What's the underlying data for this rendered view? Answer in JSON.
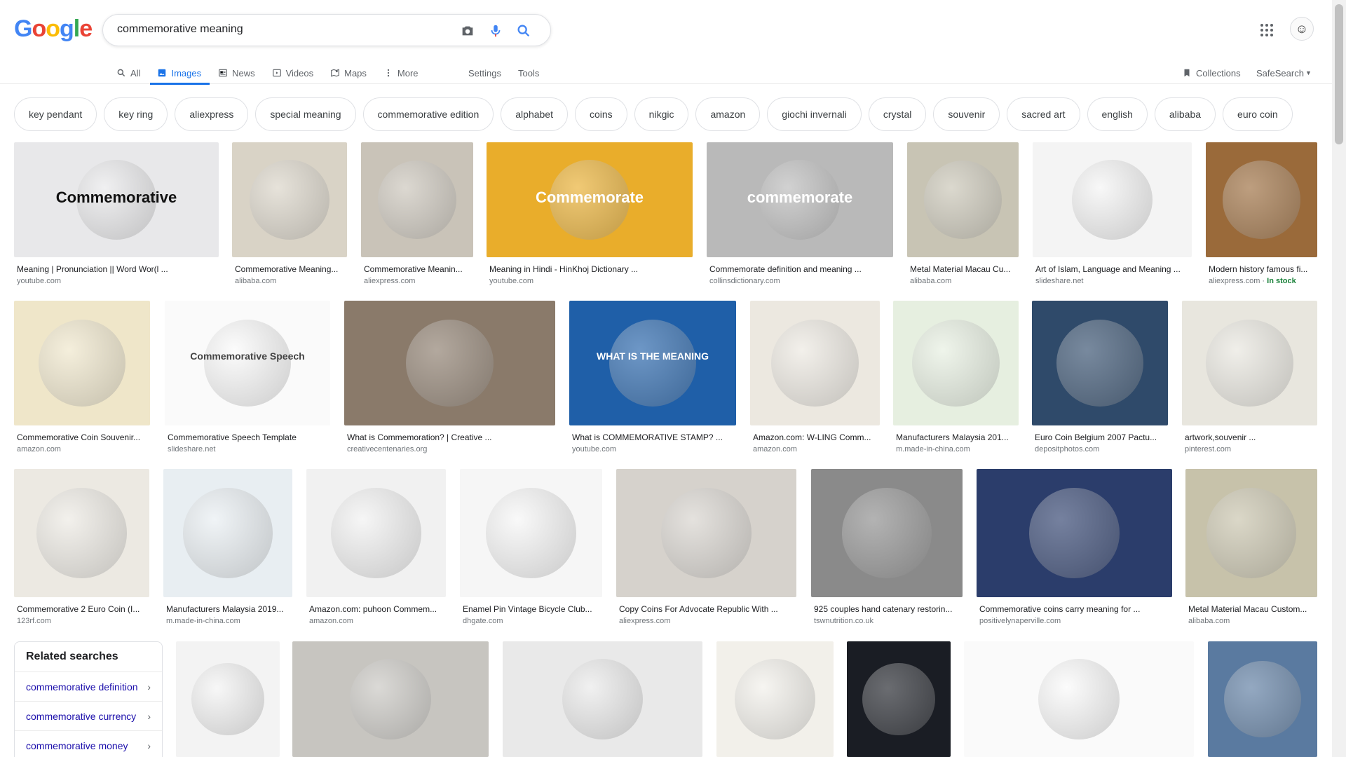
{
  "search": {
    "query": "commemorative meaning"
  },
  "logo": {
    "letters": [
      "G",
      "o",
      "o",
      "g",
      "l",
      "e"
    ],
    "colors": [
      "#4285f4",
      "#ea4335",
      "#fbbc05",
      "#4285f4",
      "#34a853",
      "#ea4335"
    ]
  },
  "tabs": [
    {
      "label": "All",
      "icon": "search-icon",
      "active": false
    },
    {
      "label": "Images",
      "icon": "image-icon",
      "active": true
    },
    {
      "label": "News",
      "icon": "news-icon",
      "active": false
    },
    {
      "label": "Videos",
      "icon": "video-icon",
      "active": false
    },
    {
      "label": "Maps",
      "icon": "map-icon",
      "active": false
    },
    {
      "label": "More",
      "icon": "more-vert-icon",
      "active": false
    }
  ],
  "tools": {
    "settings": "Settings",
    "tools": "Tools",
    "collections": "Collections",
    "safesearch": "SafeSearch"
  },
  "chips": [
    "key pendant",
    "key ring",
    "aliexpress",
    "special meaning",
    "commemorative edition",
    "alphabet",
    "coins",
    "nikgic",
    "amazon",
    "giochi invernali",
    "crystal",
    "souvenir",
    "sacred art",
    "english",
    "alibaba",
    "euro coin"
  ],
  "results": [
    {
      "title": "Meaning | Pronunciation || Word Wor(l ...",
      "source": "youtube.com",
      "bg": "#e8e8ea",
      "overlay": "Commemorative",
      "overlay_color": "#111111"
    },
    {
      "title": "Commemorative Meaning...",
      "source": "alibaba.com",
      "bg": "#d9d3c6",
      "overlay": "",
      "overlay_color": ""
    },
    {
      "title": "Commemorative Meanin...",
      "source": "aliexpress.com",
      "bg": "#c9c3b8",
      "overlay": "",
      "overlay_color": ""
    },
    {
      "title": "Meaning in Hindi - HinKhoj Dictionary ...",
      "source": "youtube.com",
      "bg": "#e9ad2b",
      "overlay": "Commemorate",
      "overlay_color": "#ffffff"
    },
    {
      "title": "Commemorate definition and meaning ...",
      "source": "collinsdictionary.com",
      "bg": "#b9b9b9",
      "overlay": "commemorate",
      "overlay_color": "#ffffff"
    },
    {
      "title": "Metal Material Macau Cu...",
      "source": "alibaba.com",
      "bg": "#c8c4b4",
      "overlay": "",
      "overlay_color": ""
    },
    {
      "title": "Art of Islam, Language and Meaning ...",
      "source": "slideshare.net",
      "bg": "#f4f4f4",
      "overlay": "",
      "overlay_color": ""
    },
    {
      "title": "Modern history famous fi...",
      "source": "aliexpress.com",
      "stock": "In stock",
      "bg": "#9a6a3a",
      "overlay": "",
      "overlay_color": ""
    },
    {
      "title": "Commemorative Coin Souvenir...",
      "source": "amazon.com",
      "bg": "#efe6c9",
      "overlay": "",
      "overlay_color": ""
    },
    {
      "title": "Commemorative Speech Template",
      "source": "slideshare.net",
      "bg": "#fafafa",
      "overlay": "Commemorative Speech",
      "overlay_color": "#444444"
    },
    {
      "title": "What is Commemoration? | Creative ...",
      "source": "creativecentenaries.org",
      "bg": "#8a7a6a",
      "overlay": "",
      "overlay_color": ""
    },
    {
      "title": "What is COMMEMORATIVE STAMP? ...",
      "source": "youtube.com",
      "bg": "#1f5fa8",
      "overlay": "WHAT IS THE MEANING",
      "overlay_color": "#ffffff"
    },
    {
      "title": "Amazon.com: W-LING Comm...",
      "source": "amazon.com",
      "bg": "#ece8e0",
      "overlay": "",
      "overlay_color": ""
    },
    {
      "title": "Manufacturers Malaysia 201...",
      "source": "m.made-in-china.com",
      "bg": "#e6efe0",
      "overlay": "",
      "overlay_color": ""
    },
    {
      "title": "Euro Coin Belgium 2007 Pactu...",
      "source": "depositphotos.com",
      "bg": "#2f4a6a",
      "overlay": "",
      "overlay_color": ""
    },
    {
      "title": "artwork,souvenir ...",
      "source": "pinterest.com",
      "bg": "#e8e6de",
      "overlay": "",
      "overlay_color": ""
    },
    {
      "title": "Commemorative 2 Euro Coin (I...",
      "source": "123rf.com",
      "bg": "#ece9e2",
      "overlay": "",
      "overlay_color": ""
    },
    {
      "title": "Manufacturers Malaysia 2019...",
      "source": "m.made-in-china.com",
      "bg": "#e8eef2",
      "overlay": "",
      "overlay_color": ""
    },
    {
      "title": "Amazon.com: puhoon Commem...",
      "source": "amazon.com",
      "bg": "#f1f1f1",
      "overlay": "",
      "overlay_color": ""
    },
    {
      "title": "Enamel Pin Vintage Bicycle Club...",
      "source": "dhgate.com",
      "bg": "#f6f6f6",
      "overlay": "",
      "overlay_color": ""
    },
    {
      "title": "Copy Coins For Advocate Republic With ...",
      "source": "aliexpress.com",
      "bg": "#d6d2cc",
      "overlay": "",
      "overlay_color": ""
    },
    {
      "title": "925 couples hand catenary restorin...",
      "source": "tswnutrition.co.uk",
      "bg": "#8a8a8a",
      "overlay": "",
      "overlay_color": ""
    },
    {
      "title": "Commemorative coins carry meaning for ...",
      "source": "positivelynaperville.com",
      "bg": "#2b3d6b",
      "overlay": "",
      "overlay_color": ""
    },
    {
      "title": "Metal Material Macau Custom...",
      "source": "alibaba.com",
      "bg": "#c7c2aa",
      "overlay": "",
      "overlay_color": ""
    },
    {
      "title": "",
      "source": "",
      "bg": "#f3f3f3",
      "overlay": "",
      "overlay_color": ""
    },
    {
      "title": "",
      "source": "",
      "bg": "#c7c5c0",
      "overlay": "",
      "overlay_color": ""
    },
    {
      "title": "",
      "source": "",
      "bg": "#e9e9e9",
      "overlay": "",
      "overlay_color": ""
    },
    {
      "title": "",
      "source": "",
      "bg": "#f2f0ea",
      "overlay": "",
      "overlay_color": ""
    },
    {
      "title": "",
      "source": "",
      "bg": "#1a1d24",
      "overlay": "",
      "overlay_color": ""
    },
    {
      "title": "",
      "source": "",
      "bg": "#fafafa",
      "overlay": "",
      "overlay_color": ""
    },
    {
      "title": "",
      "source": "",
      "bg": "#5a7aa0",
      "overlay": "",
      "overlay_color": ""
    }
  ],
  "related": {
    "heading": "Related searches",
    "items": [
      "commemorative definition",
      "commemorative currency",
      "commemorative money"
    ]
  }
}
